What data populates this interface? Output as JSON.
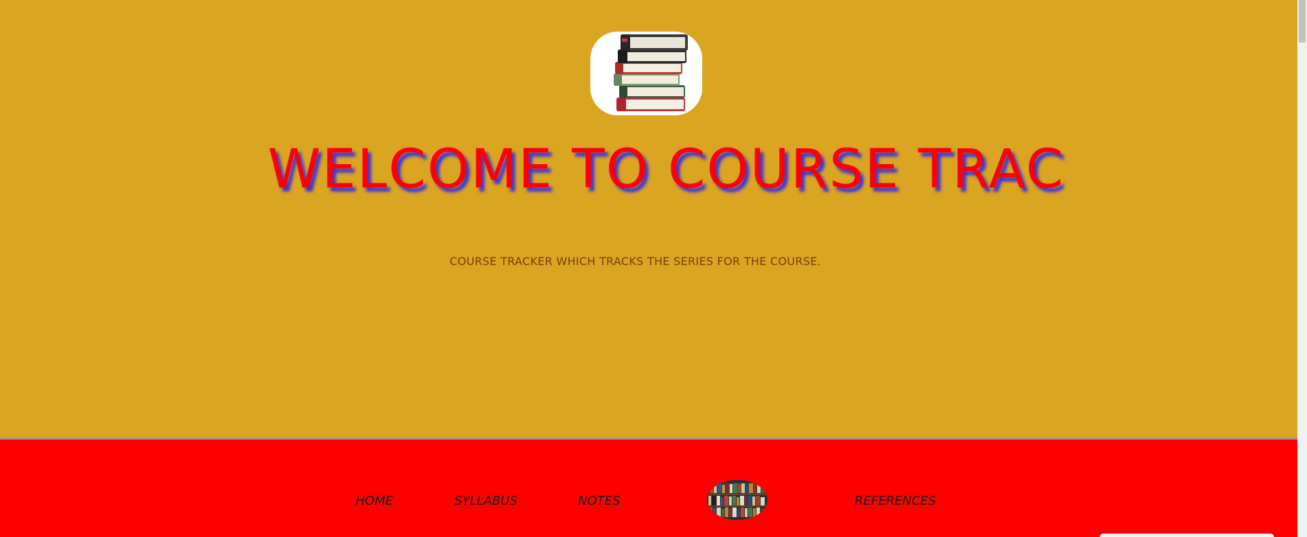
{
  "hero": {
    "logo_icon": "book-stack-icon",
    "headline": "WELCOME TO COURSE TRAC",
    "subtitle": "COURSE TRACKER WHICH TRACKS THE SERIES FOR THE COURSE."
  },
  "nav": {
    "items": [
      {
        "label": "HOME"
      },
      {
        "label": "SYLLABUS"
      },
      {
        "label": "NOTES"
      },
      {
        "label": "REFERENCES"
      }
    ],
    "avatar_icon": "bookshelf-icon"
  },
  "colors": {
    "hero_background": "#DAA520",
    "navbar_background": "#FF0000",
    "headline_color": "#FF0000",
    "headline_shadow": "#3B37D8",
    "subtitle_color": "#7A3F0B"
  }
}
